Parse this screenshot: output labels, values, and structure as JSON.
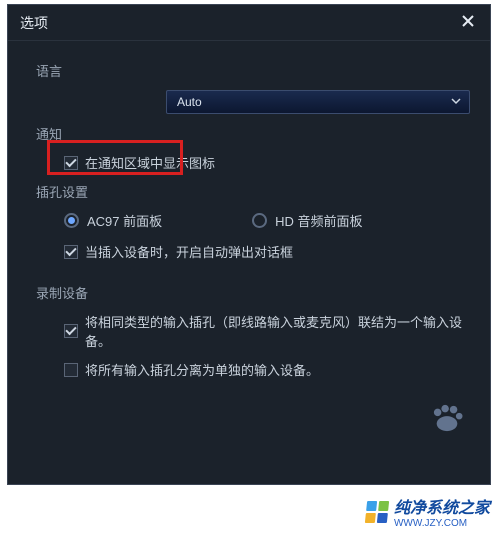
{
  "window": {
    "title": "选项",
    "close_icon": "close"
  },
  "language": {
    "label": "语言",
    "dropdown_value": "Auto"
  },
  "notification": {
    "label": "通知",
    "tray_checked": true,
    "tray_label": "在通知区域中显示图标"
  },
  "jack": {
    "label": "插孔设置",
    "ac97_selected": true,
    "ac97_label": "AC97 前面板",
    "hd_selected": false,
    "hd_label": "HD 音频前面板",
    "auto_popup_checked": true,
    "auto_popup_label": "当插入设备时，开启自动弹出对话框"
  },
  "recording": {
    "label": "录制设备",
    "combine_checked": true,
    "combine_label": "将相同类型的输入插孔（即线路输入或麦克风）联结为一个输入设备。",
    "split_checked": false,
    "split_label": "将所有输入插孔分离为单独的输入设备。"
  },
  "watermark": {
    "text": "纯净系统之家",
    "url": "WWW.JZY.COM"
  }
}
